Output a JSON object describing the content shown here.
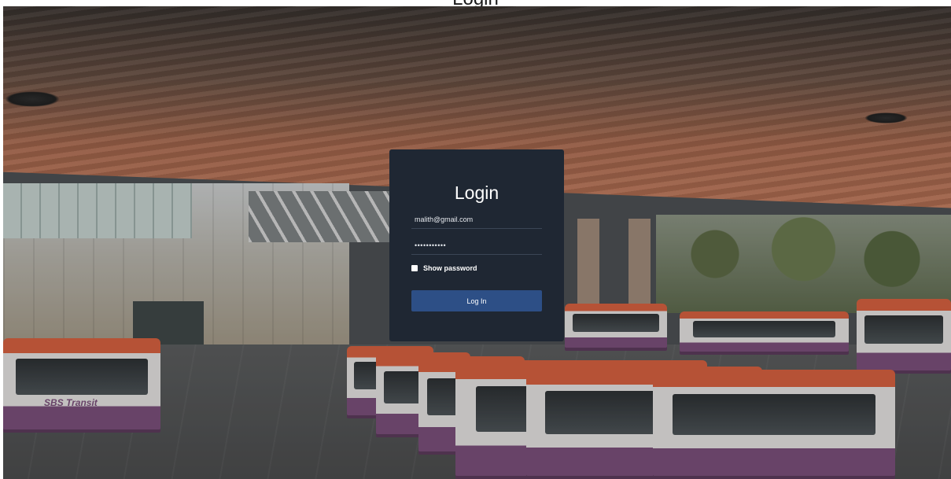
{
  "page": {
    "heading": "Login"
  },
  "login": {
    "title": "Login",
    "email_value": "malith@gmail.com",
    "password_value": "•••••••••••",
    "show_password_label": "Show password",
    "login_button_label": "Log In"
  },
  "background": {
    "bus_branding": "SBS Transit"
  },
  "colors": {
    "card_bg": "#1f2733",
    "button_bg": "#2d4f86",
    "bus_orange": "#d9603d",
    "bus_purple": "#7a4d7a"
  }
}
